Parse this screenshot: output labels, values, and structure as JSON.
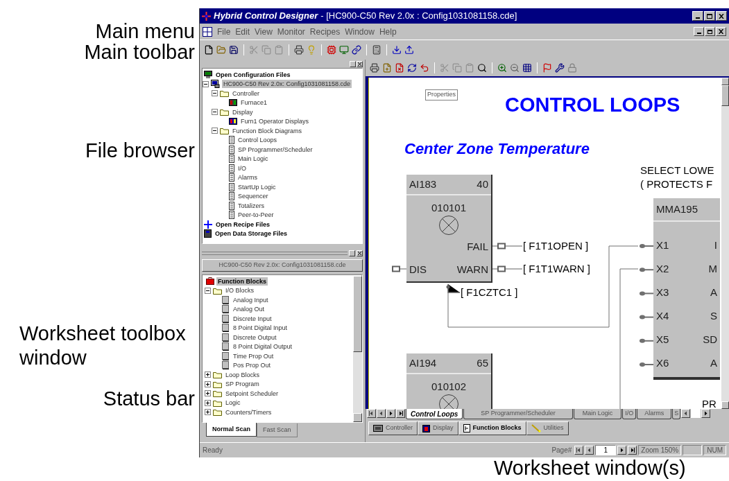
{
  "callouts": {
    "main_menu": "Main menu",
    "main_toolbar": "Main toolbar",
    "file_browser": "File browser",
    "worksheet_toolbox": "Worksheet toolbox window",
    "status_bar": "Status bar",
    "worksheet_windows": "Worksheet window(s)"
  },
  "window": {
    "app_title": "Hybrid Control Designer",
    "document_title": "- [HC900-C50 Rev 2.0x : Config1031081158.cde]"
  },
  "menu": [
    "File",
    "Edit",
    "View",
    "Monitor",
    "Recipes",
    "Window",
    "Help"
  ],
  "file_browser": {
    "tree": [
      {
        "label": "Open Configuration Files",
        "kind": "config-root",
        "selected": false,
        "children": [
          {
            "label": "HC900-C50 Rev 2.0x: Config1031081158.cde",
            "kind": "config",
            "expanded": true,
            "selected": true,
            "children": [
              {
                "label": "Controller",
                "kind": "folder",
                "expanded": true,
                "selected": false,
                "children": [
                  {
                    "label": "Furnace1",
                    "kind": "controller",
                    "selected": false
                  }
                ]
              },
              {
                "label": "Display",
                "kind": "folder",
                "expanded": true,
                "selected": false,
                "children": [
                  {
                    "label": "Furn1 Operator Displays",
                    "kind": "display",
                    "selected": false
                  }
                ]
              },
              {
                "label": "Function Block Diagrams",
                "kind": "folder",
                "expanded": true,
                "selected": false,
                "children": [
                  {
                    "label": "Control Loops",
                    "kind": "sheet",
                    "selected": false
                  },
                  {
                    "label": "SP Programmer/Scheduler",
                    "kind": "sheet",
                    "selected": false
                  },
                  {
                    "label": "Main Logic",
                    "kind": "sheet",
                    "selected": false
                  },
                  {
                    "label": "I/O",
                    "kind": "sheet",
                    "selected": false
                  },
                  {
                    "label": "Alarms",
                    "kind": "sheet",
                    "selected": false
                  },
                  {
                    "label": "StartUp Logic",
                    "kind": "sheet",
                    "selected": false
                  },
                  {
                    "label": "Sequencer",
                    "kind": "sheet",
                    "selected": false
                  },
                  {
                    "label": "Totalizers",
                    "kind": "sheet",
                    "selected": false
                  },
                  {
                    "label": "Peer-to-Peer",
                    "kind": "sheet",
                    "selected": false
                  }
                ]
              }
            ]
          }
        ]
      },
      {
        "label": "Open Recipe Files",
        "kind": "recipe-root",
        "selected": false
      },
      {
        "label": "Open Data Storage Files",
        "kind": "storage-root",
        "selected": false
      }
    ]
  },
  "toolbox": {
    "document_tab": "HC900-C50 Rev 2.0x: Config1031081158.cde",
    "tree": [
      {
        "label": "Function Blocks",
        "kind": "blocks-root",
        "selected": true,
        "children": [
          {
            "label": "I/O Blocks",
            "kind": "folder",
            "expanded": true,
            "selected": false,
            "children": [
              {
                "label": "Analog Input",
                "kind": "block",
                "selected": false
              },
              {
                "label": "Analog Out",
                "kind": "block",
                "selected": false
              },
              {
                "label": "Discrete Input",
                "kind": "block",
                "selected": false
              },
              {
                "label": "8 Point Digital Input",
                "kind": "block",
                "selected": false
              },
              {
                "label": "Discrete Output",
                "kind": "block",
                "selected": false
              },
              {
                "label": "8 Point Digital Output",
                "kind": "block",
                "selected": false
              },
              {
                "label": "Time Prop Out",
                "kind": "block",
                "selected": false
              },
              {
                "label": "Pos Prop Out",
                "kind": "block",
                "selected": false
              }
            ]
          },
          {
            "label": "Loop Blocks",
            "kind": "folder",
            "expanded": false,
            "selected": false
          },
          {
            "label": "SP Program",
            "kind": "folder",
            "expanded": false,
            "selected": false
          },
          {
            "label": "Setpoint Scheduler",
            "kind": "folder",
            "expanded": false,
            "selected": false
          },
          {
            "label": "Logic",
            "kind": "folder",
            "expanded": false,
            "selected": false
          },
          {
            "label": "Counters/Timers",
            "kind": "folder",
            "expanded": false,
            "selected": false
          }
        ]
      }
    ],
    "tabs": [
      {
        "label": "Normal Scan",
        "selected": true
      },
      {
        "label": "Fast Scan",
        "selected": false
      }
    ]
  },
  "worksheet": {
    "properties_button": "Properties",
    "title": "CONTROL LOOPS",
    "subtitle": "Center Zone Temperature",
    "note_lines": [
      "SELECT LOWE",
      "( PROTECTS F"
    ],
    "blocks": [
      {
        "name": "AI183",
        "value": "40",
        "address": "010101",
        "inputs": [
          "DIS"
        ],
        "outputs": [
          "FAIL",
          "WARN"
        ]
      },
      {
        "name": "MMA195",
        "inputs": [
          "X1",
          "X2",
          "X3",
          "X4",
          "X5",
          "X6"
        ],
        "outputs": [
          "I",
          "M",
          "A",
          "S",
          "SD",
          "A"
        ]
      },
      {
        "name": "AI194",
        "value": "65",
        "address": "010102"
      }
    ],
    "tags": [
      "[ F1T1OPEN ]",
      "[ F1T1WARN ]",
      "[ F1CZTC1 ]"
    ],
    "cut_label": "PR",
    "sheet_tabs": [
      {
        "label": "Control Loops",
        "selected": true
      },
      {
        "label": "SP Programmer/Scheduler",
        "selected": false
      },
      {
        "label": "Main Logic",
        "selected": false
      },
      {
        "label": "I/O",
        "selected": false
      },
      {
        "label": "Alarms",
        "selected": false
      },
      {
        "label": "S",
        "selected": false
      }
    ],
    "view_tabs": [
      {
        "label": "Controller",
        "kind": "controller",
        "selected": false
      },
      {
        "label": "Display",
        "kind": "display",
        "selected": false
      },
      {
        "label": "Function Blocks",
        "kind": "blocks",
        "selected": true
      },
      {
        "label": "Utilities",
        "kind": "utilities",
        "selected": false
      }
    ]
  },
  "status_bar": {
    "message": "Ready",
    "page_label": "Page#",
    "page": "1",
    "zoom": "Zoom 150%",
    "num": "NUM"
  }
}
